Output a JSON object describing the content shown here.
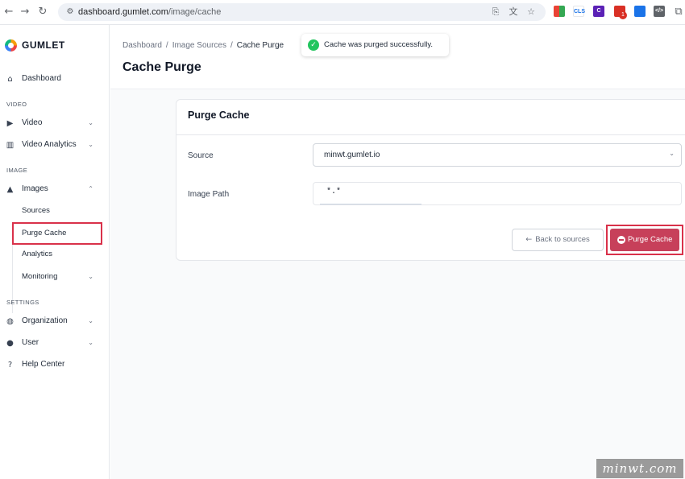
{
  "browser": {
    "url_domain": "dashboard.gumlet.com",
    "url_path": "/image/cache",
    "extensions": [
      {
        "name": "extension-1",
        "color": "#fbbc04",
        "text": ""
      },
      {
        "name": "extension-cls",
        "color": "#ffffff",
        "text": "CLS"
      },
      {
        "name": "extension-c",
        "color": "#5b21b6",
        "text": "C"
      },
      {
        "name": "extension-mail",
        "color": "#d93025",
        "text": ""
      },
      {
        "name": "extension-blue",
        "color": "#1a73e8",
        "text": ""
      },
      {
        "name": "extension-code",
        "color": "#5f6368",
        "text": "</>"
      }
    ],
    "badge_count": "1"
  },
  "sidebar": {
    "brand": "GUMLET",
    "dashboard": "Dashboard",
    "section_video": "VIDEO",
    "video": "Video",
    "video_analytics": "Video Analytics",
    "section_image": "IMAGE",
    "images": "Images",
    "sources": "Sources",
    "purge_cache": "Purge Cache",
    "analytics": "Analytics",
    "monitoring": "Monitoring",
    "section_settings": "SETTINGS",
    "organization": "Organization",
    "user": "User",
    "help_center": "Help Center"
  },
  "header": {
    "breadcrumb": [
      "Dashboard",
      "Image Sources",
      "Cache Purge"
    ],
    "title": "Cache Purge"
  },
  "toast": {
    "message": "Cache was purged successfully."
  },
  "card": {
    "title": "Purge Cache",
    "source_label": "Source",
    "source_value": "minwt.gumlet.io",
    "path_label": "Image Path",
    "path_value": "*.*",
    "back_label": "Back to sources",
    "purge_label": "Purge Cache"
  },
  "watermark": "minwt.com",
  "colors": {
    "accent": "#c7405a",
    "highlight": "#d9314a",
    "success": "#22c55e"
  }
}
